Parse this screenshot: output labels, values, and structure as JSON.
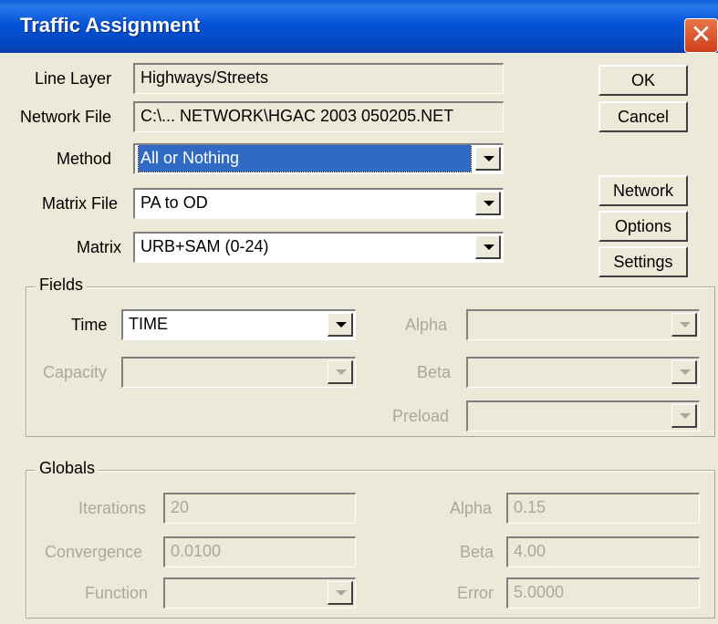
{
  "window": {
    "title": "Traffic Assignment",
    "close_label": "✕"
  },
  "top": {
    "line_layer_label": "Line Layer",
    "line_layer_value": "Highways/Streets",
    "network_file_label": "Network File",
    "network_file_value": "C:\\... NETWORK\\HGAC 2003 050205.NET",
    "method_label": "Method",
    "method_value": "All or Nothing",
    "matrix_file_label": "Matrix File",
    "matrix_file_value": "PA to OD",
    "matrix_label": "Matrix",
    "matrix_value": "URB+SAM (0-24)"
  },
  "buttons": {
    "ok": "OK",
    "cancel": "Cancel",
    "network": "Network",
    "options": "Options",
    "settings": "Settings"
  },
  "fields": {
    "legend": "Fields",
    "time_label": "Time",
    "time_value": "TIME",
    "capacity_label": "Capacity",
    "capacity_value": "",
    "alpha_label": "Alpha",
    "alpha_value": "",
    "beta_label": "Beta",
    "beta_value": "",
    "preload_label": "Preload",
    "preload_value": ""
  },
  "globals": {
    "legend": "Globals",
    "iterations_label": "Iterations",
    "iterations_value": "20",
    "convergence_label": "Convergence",
    "convergence_value": "0.0100",
    "function_label": "Function",
    "function_value": "",
    "alpha_label": "Alpha",
    "alpha_value": "0.15",
    "beta_label": "Beta",
    "beta_value": "4.00",
    "error_label": "Error",
    "error_value": "5.0000"
  },
  "icons": {
    "close": "close-icon",
    "dropdown": "chevron-down-icon"
  }
}
